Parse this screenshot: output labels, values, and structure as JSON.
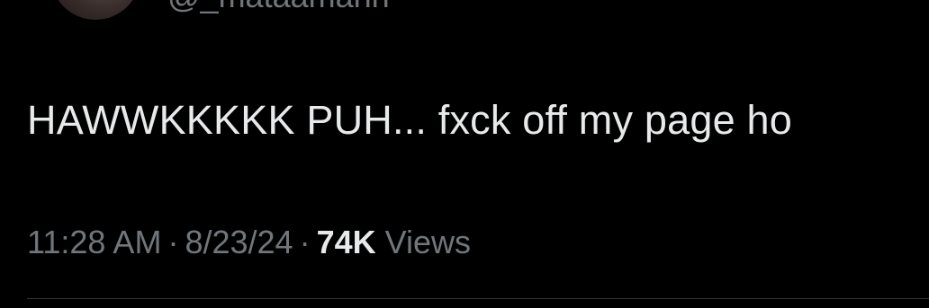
{
  "tweet": {
    "handle": "@_mataamahh",
    "text": "HAWWKKKKK PUH... fxck off my page ho",
    "time": "11:28 AM",
    "date": "8/23/24",
    "separator": "·",
    "views_count": "74K",
    "views_label": "Views"
  },
  "colors": {
    "background": "#000000",
    "primary_text": "#e7e9ea",
    "secondary_text": "#71767b",
    "divider": "#2f3336"
  }
}
